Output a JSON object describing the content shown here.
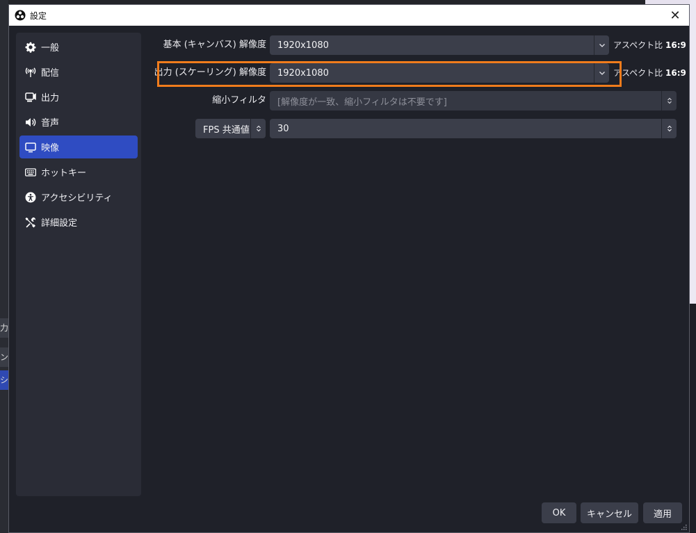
{
  "window": {
    "title": "設定",
    "close_glyph": "✕",
    "app_icon": "obs-logo-icon"
  },
  "background_fragments": [
    "力",
    "ン",
    "シ"
  ],
  "sidebar": {
    "items": [
      {
        "label": "一般",
        "icon": "gear-icon",
        "active": false
      },
      {
        "label": "配信",
        "icon": "broadcast-antenna-icon",
        "active": false
      },
      {
        "label": "出力",
        "icon": "output-camera-icon",
        "active": false
      },
      {
        "label": "音声",
        "icon": "speaker-icon",
        "active": false
      },
      {
        "label": "映像",
        "icon": "monitor-icon",
        "active": true
      },
      {
        "label": "ホットキー",
        "icon": "keyboard-icon",
        "active": false
      },
      {
        "label": "アクセシビリティ",
        "icon": "accessibility-icon",
        "active": false
      },
      {
        "label": "詳細設定",
        "icon": "tools-icon",
        "active": false
      }
    ]
  },
  "video": {
    "base_resolution": {
      "label": "基本 (キャンバス) 解像度",
      "value": "1920x1080",
      "aspect_label": "アスペクト比",
      "aspect_value": "16:9"
    },
    "output_resolution": {
      "label": "出力 (スケーリング) 解像度",
      "value": "1920x1080",
      "aspect_label": "アスペクト比",
      "aspect_value": "16:9"
    },
    "downscale_filter": {
      "label": "縮小フィルタ",
      "value": "[解像度が一致、縮小フィルタは不要です]"
    },
    "fps": {
      "type_label": "FPS 共通値",
      "value": "30"
    }
  },
  "buttons": {
    "ok": "OK",
    "cancel": "キャンセル",
    "apply": "適用"
  },
  "colors": {
    "accent": "#2f4cc2",
    "highlight_border": "#f07c1c",
    "dialog_bg": "#1f2129",
    "sidebar_bg": "#2a2c36",
    "control_bg": "#3b3e4a"
  }
}
